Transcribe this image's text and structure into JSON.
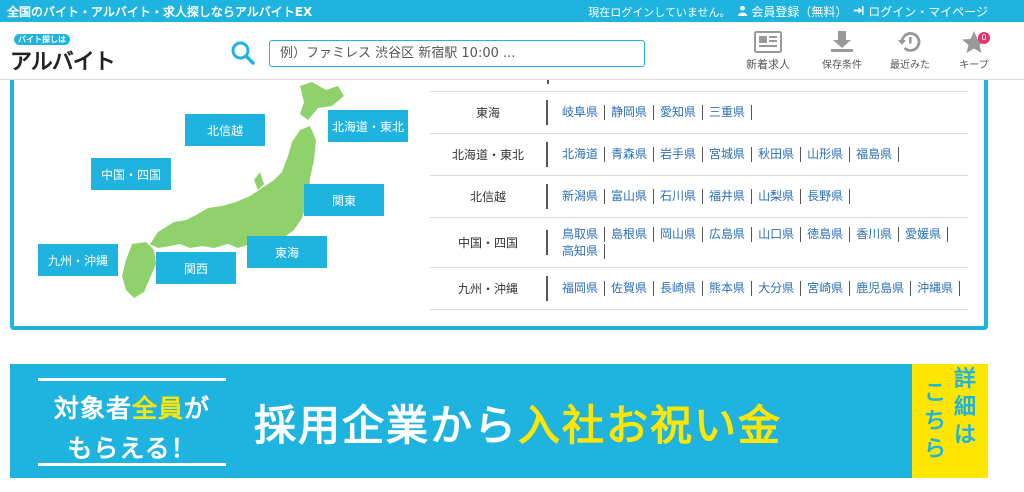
{
  "topbar": {
    "tagline": "全国のバイト・アルバイト・求人探しならアルバイトEX",
    "login_status": "現在ログインしていません。",
    "register": "会員登録（無料）",
    "login": "ログイン・マイページ"
  },
  "header": {
    "logo_sub": "バイト探しは",
    "logo_main": "アルバイト",
    "logo_ex": "EX",
    "search_placeholder": "例）ファミレス 渋谷区 新宿駅 10:00 ...",
    "nav": [
      {
        "label": "新着求人",
        "icon": "newspaper-icon"
      },
      {
        "label": "保存条件",
        "icon": "download-icon"
      },
      {
        "label": "最近みた",
        "icon": "history-icon"
      },
      {
        "label": "キープ",
        "icon": "star-icon",
        "badge": "0"
      }
    ]
  },
  "map": {
    "colors": {
      "land": "#8fd26b",
      "button": "#1fb4df"
    },
    "regions": [
      {
        "label": "北信越"
      },
      {
        "label": "北海道・東北"
      },
      {
        "label": "中国・四国"
      },
      {
        "label": "関東"
      },
      {
        "label": "九州・沖縄"
      },
      {
        "label": "東海"
      },
      {
        "label": "関西"
      }
    ]
  },
  "table": {
    "rows": [
      {
        "region": "東海",
        "prefs": [
          "岐阜県",
          "静岡県",
          "愛知県",
          "三重県"
        ]
      },
      {
        "region": "北海道・東北",
        "prefs": [
          "北海道",
          "青森県",
          "岩手県",
          "宮城県",
          "秋田県",
          "山形県",
          "福島県"
        ]
      },
      {
        "region": "北信越",
        "prefs": [
          "新潟県",
          "富山県",
          "石川県",
          "福井県",
          "山梨県",
          "長野県"
        ]
      },
      {
        "region": "中国・四国",
        "prefs": [
          "鳥取県",
          "島根県",
          "岡山県",
          "広島県",
          "山口県",
          "徳島県",
          "香川県",
          "愛媛県",
          "高知県"
        ]
      },
      {
        "region": "九州・沖縄",
        "prefs": [
          "福岡県",
          "佐賀県",
          "長崎県",
          "熊本県",
          "大分県",
          "宮崎県",
          "鹿児島県",
          "沖縄県"
        ]
      }
    ]
  },
  "banner": {
    "left_line1_a": "対象者",
    "left_line1_b": "全員",
    "left_line1_c": "が",
    "left_line2": "もらえる！",
    "main_a": "採用企業から",
    "main_b": "入社お祝い金",
    "cta_col1": "こちら",
    "cta_col2": "詳細は"
  }
}
